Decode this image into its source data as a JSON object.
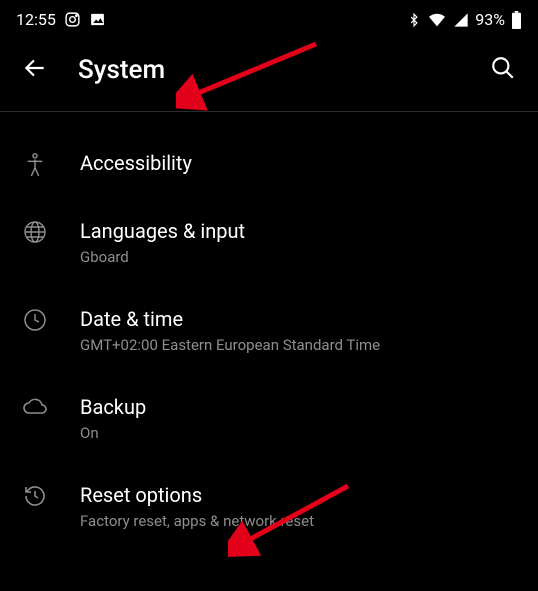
{
  "status": {
    "time": "12:55",
    "battery": "93%"
  },
  "header": {
    "title": "System"
  },
  "items": [
    {
      "label": "Accessibility",
      "sub": ""
    },
    {
      "label": "Languages & input",
      "sub": "Gboard"
    },
    {
      "label": "Date & time",
      "sub": "GMT+02:00 Eastern European Standard Time"
    },
    {
      "label": "Backup",
      "sub": "On"
    },
    {
      "label": "Reset options",
      "sub": "Factory reset, apps & network reset"
    }
  ]
}
